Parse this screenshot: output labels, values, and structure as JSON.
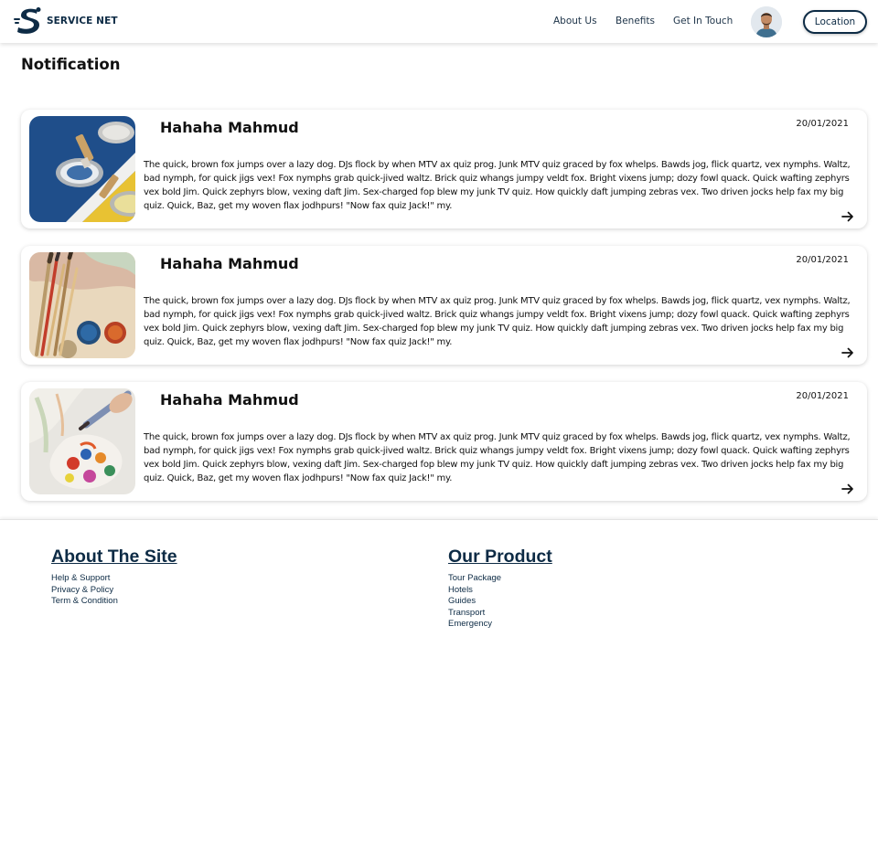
{
  "header": {
    "brand": "SERVICE NET",
    "nav": [
      {
        "label": "About Us"
      },
      {
        "label": "Benefits"
      },
      {
        "label": "Get In Touch"
      }
    ],
    "location_label": "Location"
  },
  "page": {
    "title": "Notification"
  },
  "notifications": [
    {
      "name": "Hahaha Mahmud",
      "date": "20/01/2021",
      "text": "The quick, brown fox jumps over a lazy dog. DJs flock by when MTV ax quiz prog. Junk MTV quiz graced by fox whelps. Bawds jog, flick quartz, vex nymphs. Waltz, bad nymph, for quick jigs vex! Fox nymphs grab quick-jived waltz. Brick quiz whangs jumpy veldt fox. Bright vixens jump; dozy fowl quack. Quick wafting zephyrs vex bold Jim. Quick zephyrs blow, vexing daft Jim. Sex-charged fop blew my junk TV quiz. How quickly daft jumping zebras vex. Two driven jocks help fax my big quiz. Quick, Baz, get my woven flax jodhpurs! \"Now fax quiz Jack!\" my."
    },
    {
      "name": "Hahaha Mahmud",
      "date": "20/01/2021",
      "text": "The quick, brown fox jumps over a lazy dog. DJs flock by when MTV ax quiz prog. Junk MTV quiz graced by fox whelps. Bawds jog, flick quartz, vex nymphs. Waltz, bad nymph, for quick jigs vex! Fox nymphs grab quick-jived waltz. Brick quiz whangs jumpy veldt fox. Bright vixens jump; dozy fowl quack. Quick wafting zephyrs vex bold Jim. Quick zephyrs blow, vexing daft Jim. Sex-charged fop blew my junk TV quiz. How quickly daft jumping zebras vex. Two driven jocks help fax my big quiz. Quick, Baz, get my woven flax jodhpurs! \"Now fax quiz Jack!\" my."
    },
    {
      "name": "Hahaha Mahmud",
      "date": "20/01/2021",
      "text": "The quick, brown fox jumps over a lazy dog. DJs flock by when MTV ax quiz prog. Junk MTV quiz graced by fox whelps. Bawds jog, flick quartz, vex nymphs. Waltz, bad nymph, for quick jigs vex! Fox nymphs grab quick-jived waltz. Brick quiz whangs jumpy veldt fox. Bright vixens jump; dozy fowl quack. Quick wafting zephyrs vex bold Jim. Quick zephyrs blow, vexing daft Jim. Sex-charged fop blew my junk TV quiz. How quickly daft jumping zebras vex. Two driven jocks help fax my big quiz. Quick, Baz, get my woven flax jodhpurs! \"Now fax quiz Jack!\" my."
    }
  ],
  "footer": {
    "about": {
      "heading": "About The Site",
      "links": [
        "Help & Support",
        "Privacy & Policy",
        "Term & Condition"
      ]
    },
    "product": {
      "heading": "Our Product",
      "links": [
        "Tour Package",
        "Hotels",
        "Guides",
        "Transport",
        "Emergency"
      ]
    }
  },
  "colors": {
    "brand_navy": "#0d2b45",
    "card_background": "#ffffff"
  },
  "icons": {
    "logo": "service-net-logo-icon",
    "arrow": "arrow-right-icon"
  }
}
